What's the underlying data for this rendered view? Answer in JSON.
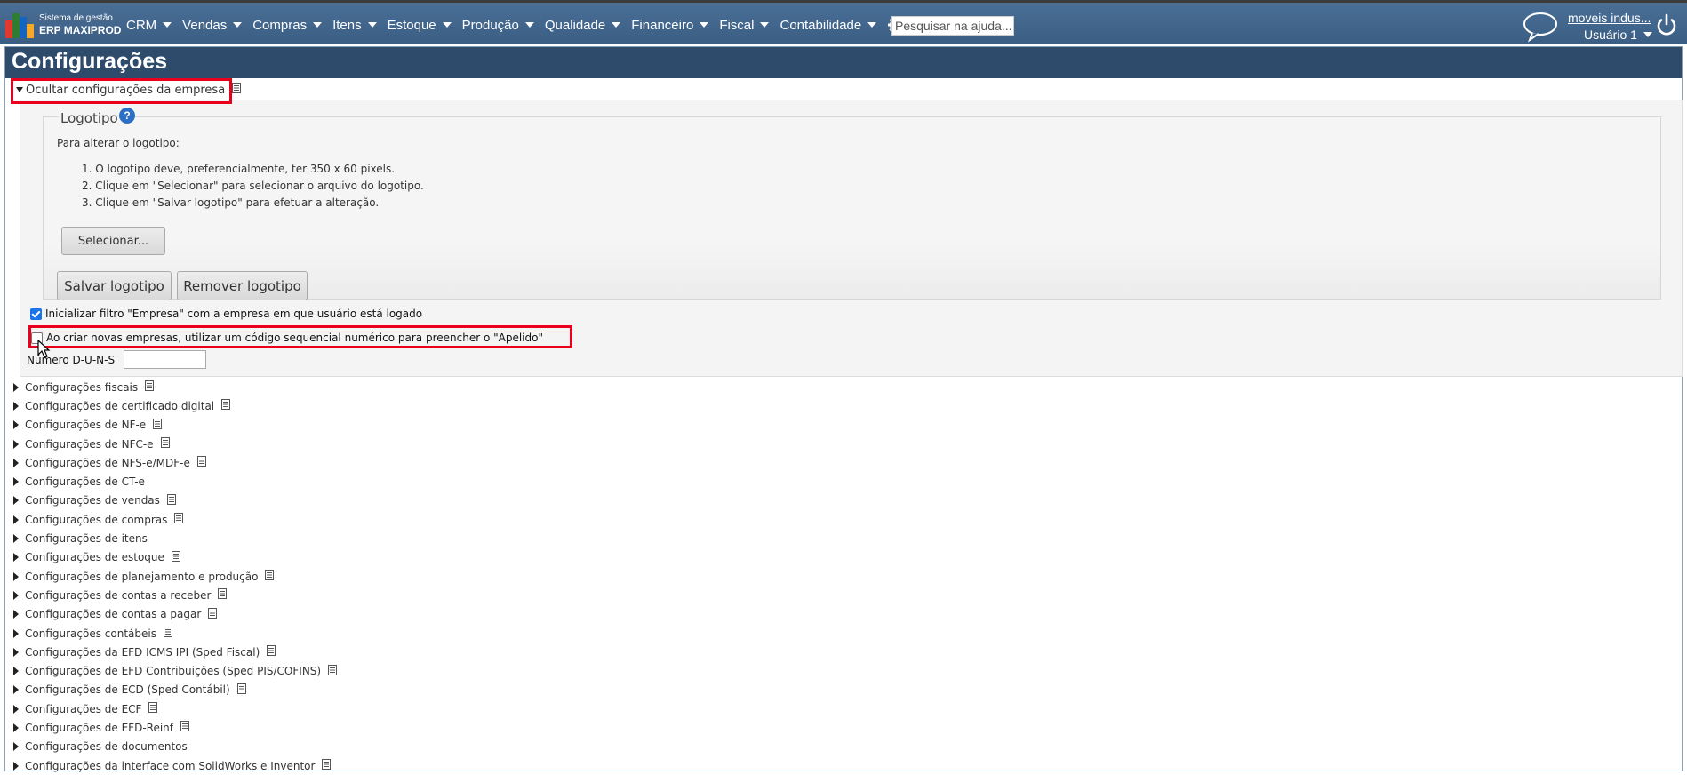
{
  "brand": {
    "line1": "Sistema de gestão",
    "line2": "ERP MAXIPROD"
  },
  "menu": [
    {
      "label": "CRM"
    },
    {
      "label": "Vendas"
    },
    {
      "label": "Compras"
    },
    {
      "label": "Itens"
    },
    {
      "label": "Estoque"
    },
    {
      "label": "Produção"
    },
    {
      "label": "Qualidade"
    },
    {
      "label": "Financeiro"
    },
    {
      "label": "Fiscal"
    },
    {
      "label": "Contabilidade"
    }
  ],
  "search": {
    "placeholder": "Pesquisar na ajuda..."
  },
  "account": {
    "company": "moveis indus...",
    "user": "Usuário 1"
  },
  "page": {
    "title": "Configurações"
  },
  "company_section": {
    "toggle_label": "Ocultar configurações da empresa",
    "logo_legend": "Logotipo",
    "help_glyph": "?",
    "instructions_intro": "Para alterar o logotipo:",
    "instructions": [
      "1. O logotipo deve, preferencialmente, ter 350 x 60 pixels.",
      "2. Clique em \"Selecionar\" para selecionar o arquivo do logotipo.",
      "3. Clique em \"Salvar logotipo\" para efetuar a alteração."
    ],
    "select_label": "Selecionar...",
    "save_label": "Salvar logotipo",
    "remove_label": "Remover logotipo",
    "filter_checkbox": {
      "label": "Inicializar filtro \"Empresa\" com a empresa em que usuário está logado",
      "checked": true
    },
    "sequential_checkbox": {
      "label": "Ao criar novas empresas, utilizar um código sequencial numérico para preencher o \"Apelido\"",
      "checked": false
    },
    "duns_label": "Número D-U-N-S",
    "duns_value": ""
  },
  "config_sections": [
    {
      "label": "Configurações fiscais",
      "doc": true
    },
    {
      "label": "Configurações de certificado digital",
      "doc": true
    },
    {
      "label": "Configurações de NF-e",
      "doc": true
    },
    {
      "label": "Configurações de NFC-e",
      "doc": true
    },
    {
      "label": "Configurações de NFS-e/MDF-e",
      "doc": true
    },
    {
      "label": "Configurações de CT-e",
      "doc": false
    },
    {
      "label": "Configurações de vendas",
      "doc": true
    },
    {
      "label": "Configurações de compras",
      "doc": true
    },
    {
      "label": "Configurações de itens",
      "doc": false
    },
    {
      "label": "Configurações de estoque",
      "doc": true
    },
    {
      "label": "Configurações de planejamento e produção",
      "doc": true
    },
    {
      "label": "Configurações de contas a receber",
      "doc": true
    },
    {
      "label": "Configurações de contas a pagar",
      "doc": true
    },
    {
      "label": "Configurações contábeis",
      "doc": true
    },
    {
      "label": "Configurações da EFD ICMS IPI (Sped Fiscal)",
      "doc": true
    },
    {
      "label": "Configurações de EFD Contribuições (Sped PIS/COFINS)",
      "doc": true
    },
    {
      "label": "Configurações de ECD (Sped Contábil)",
      "doc": true
    },
    {
      "label": "Configurações de ECF",
      "doc": true
    },
    {
      "label": "Configurações de EFD-Reinf",
      "doc": true
    },
    {
      "label": "Configurações de documentos",
      "doc": false
    },
    {
      "label": "Configurações da interface com SolidWorks e Inventor",
      "doc": true
    }
  ],
  "colors": {
    "topbar": "#3f6389",
    "titlebar": "#2f4b6b",
    "highlight": "#e8001c",
    "help": "#2d6fc4"
  }
}
